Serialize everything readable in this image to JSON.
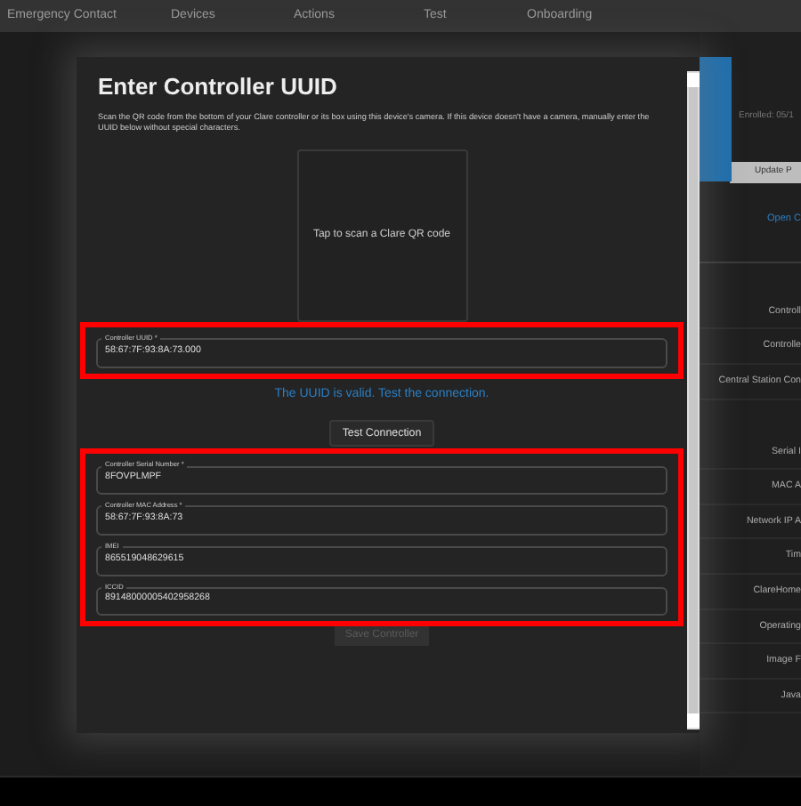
{
  "nav": {
    "items": [
      "Emergency Contact",
      "Devices",
      "Actions",
      "Test",
      "Onboarding"
    ]
  },
  "side_panel": {
    "enrolled": "Enrolled: 05/1",
    "update_button": "Update P",
    "link": "Open C",
    "labels": [
      "Controll",
      "Controlle",
      "Central Station Con",
      "Serial I",
      "MAC A",
      "Network IP A",
      "Tim",
      "ClareHome",
      "Operating",
      "Image F",
      "Java"
    ]
  },
  "dialog": {
    "title": "Enter Controller UUID",
    "description": "Scan the QR code from the bottom of your Clare controller or its box using this device's camera. If this device doesn't have a camera, manually enter the UUID below without special characters.",
    "scan_prompt": "Tap to scan a Clare QR code",
    "uuid_field": {
      "label": "Controller UUID *",
      "value": "58:67:7F:93:8A:73.000",
      "highlighted": true
    },
    "validation_message": "The UUID is valid. Test the connection.",
    "test_button": {
      "label": "Test Connection",
      "disabled": false
    },
    "details_highlighted": true,
    "fields": [
      {
        "label": "Controller Serial Number *",
        "value": "8FOVPLMPF"
      },
      {
        "label": "Controller MAC Address *",
        "value": "58:67:7F:93:8A:73"
      },
      {
        "label": "IMEI",
        "value": "865519048629615"
      },
      {
        "label": "ICCID",
        "value": "89148000005402958268"
      }
    ],
    "save_button": {
      "label": "Save Controller",
      "disabled": true
    }
  }
}
